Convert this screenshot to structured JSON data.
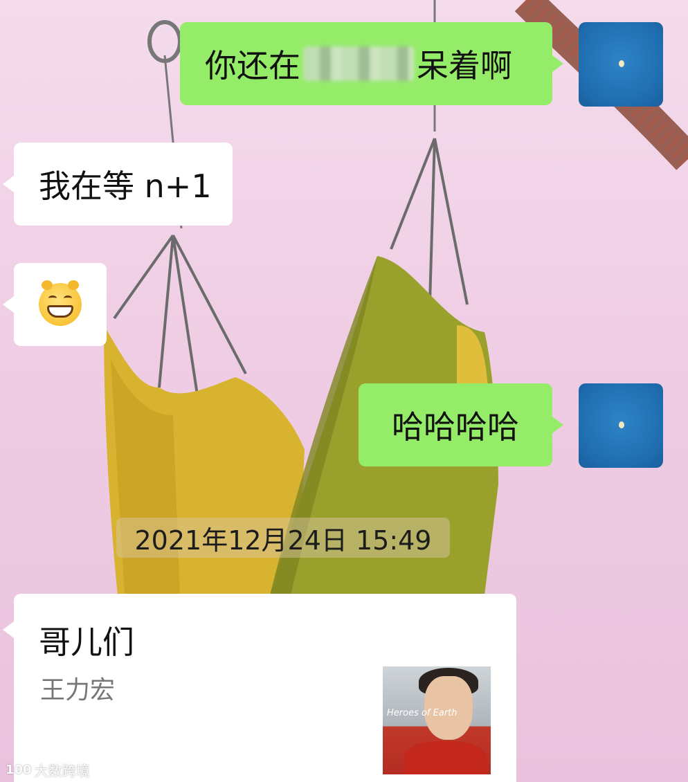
{
  "chat": {
    "messages": [
      {
        "side": "out",
        "text_before": "你还在",
        "text_after": "呆着啊",
        "redacted": true
      },
      {
        "side": "in",
        "text": "我在等 n+1"
      },
      {
        "side": "in",
        "emoji": "grinning-cat-face"
      },
      {
        "side": "out",
        "text": "哈哈哈哈"
      }
    ],
    "timestamp": "2021年12月24日 15:49",
    "music_card": {
      "title": "哥儿们",
      "artist": "王力宏",
      "album_text": "Heroes of Earth"
    }
  },
  "watermark": {
    "icon": "100",
    "text": "大数跨境"
  },
  "colors": {
    "outgoing_bubble": "#95ec69",
    "incoming_bubble": "#ffffff",
    "avatar": "#1f6db0",
    "background": "#efcde4"
  },
  "icons": {
    "avatar": "moon-avatar-icon",
    "emoji": "grinning-face-emoji-icon"
  }
}
